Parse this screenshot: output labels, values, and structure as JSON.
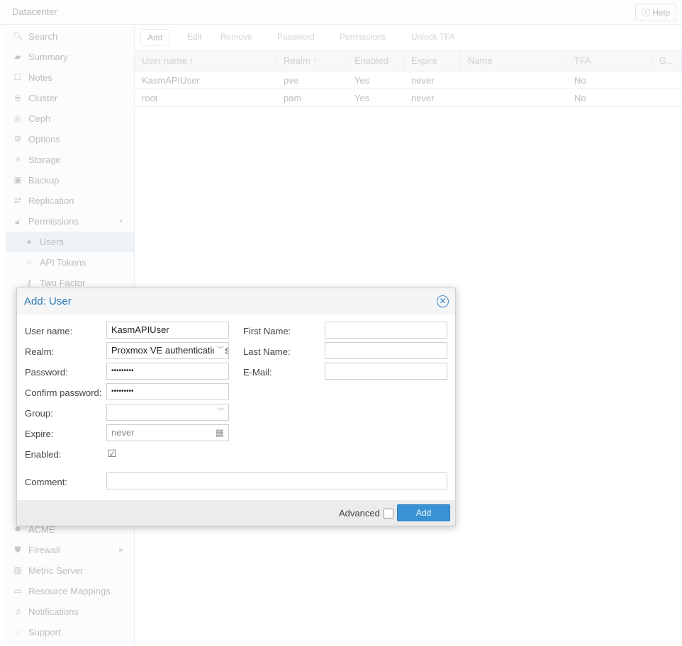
{
  "header": {
    "title": "Datacenter",
    "help": "Help"
  },
  "sidebar": {
    "items": [
      {
        "label": "Search",
        "icon": "search-icon",
        "glyph": "🔍︎"
      },
      {
        "label": "Summary",
        "icon": "book-icon",
        "glyph": "▰"
      },
      {
        "label": "Notes",
        "icon": "note-icon",
        "glyph": "☐"
      },
      {
        "label": "Cluster",
        "icon": "server-icon",
        "glyph": "≣"
      },
      {
        "label": "Ceph",
        "icon": "ceph-icon",
        "glyph": "◎"
      },
      {
        "label": "Options",
        "icon": "gear-icon",
        "glyph": "⚙"
      },
      {
        "label": "Storage",
        "icon": "database-icon",
        "glyph": "≡"
      },
      {
        "label": "Backup",
        "icon": "floppy-icon",
        "glyph": "▣"
      },
      {
        "label": "Replication",
        "icon": "retweet-icon",
        "glyph": "⇄"
      },
      {
        "label": "Permissions",
        "icon": "unlock-icon",
        "glyph": "🔓︎"
      },
      {
        "label": "Users",
        "icon": "user-icon",
        "glyph": "●"
      },
      {
        "label": "API Tokens",
        "icon": "user-outline-icon",
        "glyph": "○"
      },
      {
        "label": "Two Factor",
        "icon": "key-icon",
        "glyph": "⚷"
      }
    ],
    "bottom_items": [
      {
        "label": "ACME",
        "icon": "certificate-icon",
        "glyph": "✹"
      },
      {
        "label": "Firewall",
        "icon": "shield-icon",
        "glyph": "⛊"
      },
      {
        "label": "Metric Server",
        "icon": "bar-chart-icon",
        "glyph": "▥"
      },
      {
        "label": "Resource Mappings",
        "icon": "folder-icon",
        "glyph": "▭"
      },
      {
        "label": "Notifications",
        "icon": "bell-icon",
        "glyph": "♫"
      },
      {
        "label": "Support",
        "icon": "comments-icon",
        "glyph": "◌"
      }
    ]
  },
  "toolbar": {
    "add": "Add",
    "edit": "Edit",
    "remove": "Remove",
    "password": "Password",
    "permissions": "Permissions",
    "unlock_tfa": "Unlock TFA"
  },
  "grid": {
    "columns": [
      "User name ↑",
      "Realm ↑",
      "Enabled",
      "Expire",
      "Name",
      "TFA",
      "G.."
    ],
    "rows": [
      [
        "KasmAPIUser",
        "pve",
        "Yes",
        "never",
        "",
        "No"
      ],
      [
        "root",
        "pam",
        "Yes",
        "never",
        "",
        "No"
      ]
    ]
  },
  "dialog": {
    "title": "Add: User",
    "labels": {
      "username": "User name:",
      "realm": "Realm:",
      "password": "Password:",
      "confirm": "Confirm password:",
      "group": "Group:",
      "expire": "Expire:",
      "enabled": "Enabled:",
      "comment": "Comment:",
      "first": "First Name:",
      "last": "Last Name:",
      "email": "E-Mail:"
    },
    "values": {
      "username": "KasmAPIUser",
      "realm": "Proxmox VE authentication server",
      "password": "•••••••••",
      "confirm": "•••••••••",
      "group": "",
      "expire_placeholder": "never",
      "enabled": true,
      "comment": "",
      "first": "",
      "last": "",
      "email": ""
    },
    "advanced": "Advanced",
    "add_button": "Add"
  }
}
